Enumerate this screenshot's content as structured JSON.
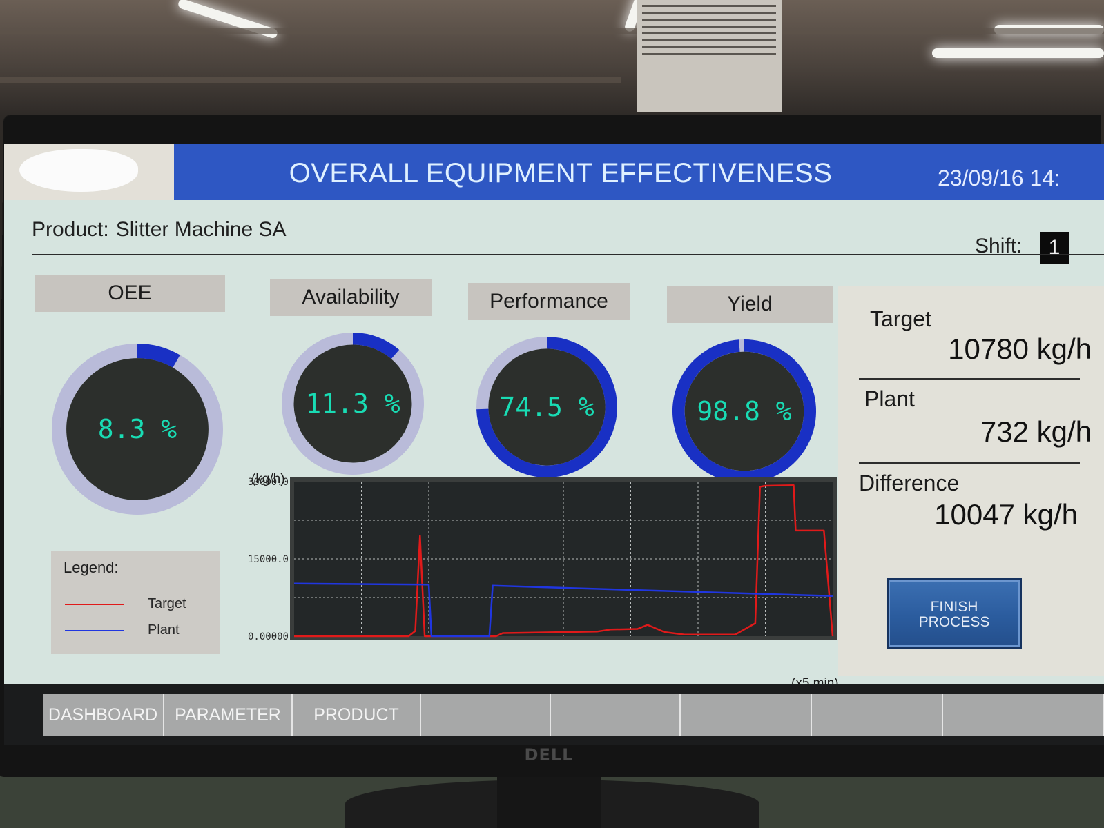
{
  "header": {
    "title": "OVERALL EQUIPMENT EFFECTIVENESS",
    "datetime": "23/09/16  14:"
  },
  "product": {
    "label": "Product:",
    "value": "Slitter Machine SA"
  },
  "shift": {
    "label": "Shift:",
    "value": "1"
  },
  "kpis": [
    {
      "label": "OEE",
      "value_text": "8.3 %",
      "fraction": 0.083
    },
    {
      "label": "Availability",
      "value_text": "11.3 %",
      "fraction": 0.113
    },
    {
      "label": "Performance",
      "value_text": "74.5 %",
      "fraction": 0.745
    },
    {
      "label": "Yield",
      "value_text": "98.8 %",
      "fraction": 0.988
    }
  ],
  "colors": {
    "gauge_ring": "#b9bbd9",
    "gauge_fill": "#1930c4",
    "gauge_face": "#2c2f2c",
    "target_line": "#e01a1a",
    "plant_line": "#2036e0"
  },
  "legend": {
    "title": "Legend:",
    "items": [
      {
        "label": "Target",
        "color": "#e01a1a"
      },
      {
        "label": "Plant",
        "color": "#2036e0"
      }
    ]
  },
  "chart_data": {
    "type": "line",
    "ylabel": "(kg/h)",
    "xlabel": "(x5 min)",
    "ylim": [
      0,
      30000
    ],
    "y_ticks": [
      "30000.0",
      "15000.0",
      "0.00000"
    ],
    "xlim": [
      0,
      8
    ],
    "grid": true,
    "series": [
      {
        "name": "Target",
        "color": "#e01a1a",
        "x": [
          0,
          1.7,
          1.8,
          1.87,
          1.94,
          3.0,
          3.1,
          4.5,
          4.7,
          5.1,
          5.25,
          5.5,
          5.8,
          6.55,
          6.85,
          6.92,
          7.0,
          7.42,
          7.45,
          7.87,
          8.0
        ],
        "y": [
          0,
          0,
          1000,
          19500,
          0,
          0,
          600,
          900,
          1300,
          1400,
          2200,
          800,
          300,
          300,
          2500,
          29000,
          29200,
          29300,
          20500,
          20500,
          0
        ]
      },
      {
        "name": "Plant",
        "color": "#2036e0",
        "x": [
          0,
          2.0,
          2.04,
          2.9,
          2.95,
          8.0
        ],
        "y": [
          10200,
          10000,
          0,
          0,
          9800,
          7800
        ]
      }
    ]
  },
  "side_panel": {
    "target_label": "Target",
    "target_value": "10780  kg/h",
    "plant_label": "Plant",
    "plant_value": "732  kg/h",
    "difference_label": "Difference",
    "difference_value": "10047  kg/h",
    "finish_line1": "FINISH",
    "finish_line2": "PROCESS"
  },
  "nav": {
    "tabs": [
      "DASHBOARD",
      "PARAMETER",
      "PRODUCT",
      "",
      "",
      "",
      "",
      ""
    ]
  },
  "monitor_brand": "DELL"
}
